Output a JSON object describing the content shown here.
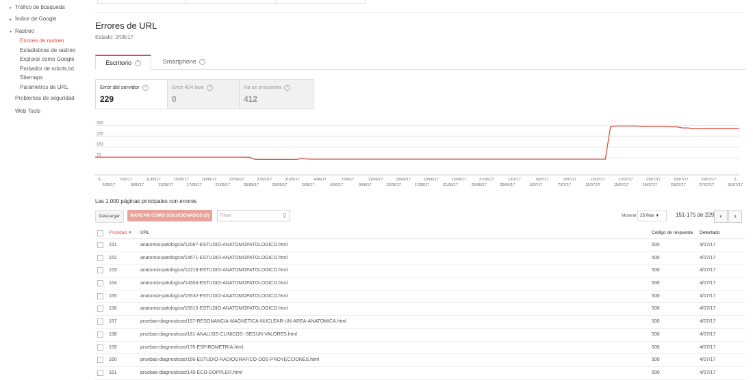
{
  "sidebar": {
    "traffic": "Tráfico de búsqueda",
    "index": "Índice de Google",
    "crawl": "Rastreo",
    "sub": [
      "Errores de rastreo",
      "Estadísticas de rastreo",
      "Explorar como Google",
      "Probador de robots.txt",
      "Sitemaps",
      "Parámetros de URL"
    ],
    "security": "Problemas de seguridad",
    "webtools": "Web Tools"
  },
  "header": {
    "title": "Errores de URL",
    "state": "Estado: 2/08/17"
  },
  "tabs": [
    {
      "label": "Escritorio"
    },
    {
      "label": "Smartphone"
    }
  ],
  "cards": [
    {
      "label": "Error del servidor",
      "value": "229"
    },
    {
      "label": "Error 404 leve",
      "value": "0"
    },
    {
      "label": "No se encuentra",
      "value": "412"
    }
  ],
  "chart_data": {
    "type": "line",
    "y_ticks": [
      300,
      225,
      150,
      75
    ],
    "ylim": [
      0,
      330
    ],
    "x_labels_top": [
      "3...",
      "7/05/17",
      "11/05/17",
      "15/05/17",
      "19/05/17",
      "23/05/17",
      "27/05/17",
      "31/05/17",
      "4/06/17",
      "7/06/17",
      "11/06/17",
      "15/06/17",
      "19/06/17",
      "23/06/17",
      "27/06/17",
      "1/07/17",
      "5/07/17",
      "9/07/17",
      "13/07/17",
      "17/07/17",
      "21/07/17",
      "25/07/17",
      "29/07/17",
      "2..."
    ],
    "x_labels_bottom": [
      "5/05/17",
      "9/05/17",
      "13/05/17",
      "17/05/17",
      "21/05/17",
      "25/05/17",
      "29/05/17",
      "2/06/17",
      "6/06/17",
      "9/06/17",
      "13/06/17",
      "17/06/17",
      "21/06/17",
      "25/06/17",
      "29/06/17",
      "3/07/17",
      "7/07/17",
      "11/07/17",
      "15/07/17",
      "19/07/17",
      "23/07/17",
      "27/07/17",
      "31/07/17"
    ],
    "series": [
      {
        "values": [
          80,
          80,
          80,
          80,
          80,
          80,
          80,
          80,
          80,
          80,
          80,
          80,
          80,
          80,
          80,
          80,
          80,
          80,
          80,
          80,
          80,
          80,
          80,
          80,
          80,
          80,
          80,
          80,
          80,
          80,
          79,
          65,
          64,
          64,
          64,
          64,
          64,
          64,
          64,
          64,
          70,
          68,
          66,
          66,
          66,
          66,
          66,
          66,
          66,
          66,
          66,
          66,
          66,
          66,
          66,
          66,
          66,
          66,
          66,
          66,
          66,
          66,
          66,
          66,
          66,
          66,
          66,
          66,
          66,
          66,
          66,
          66,
          66,
          66,
          66,
          66,
          66,
          66,
          66,
          66,
          66,
          66,
          66,
          66,
          66,
          66,
          66,
          66,
          66,
          66,
          66,
          66,
          66,
          66,
          66,
          66,
          66,
          66,
          66,
          66
        ]
      }
    ],
    "series_tail": [
      290,
      295,
      295,
      295,
      295,
      295,
      293,
      292,
      292,
      292,
      292,
      290,
      290,
      289,
      282,
      282,
      277,
      277,
      277,
      277,
      277,
      277,
      277,
      277,
      277,
      276
    ]
  },
  "table": {
    "subtitle": "Las 1.000 páginas principales con errores",
    "download": "Descargar",
    "mark": "MARCAR COMO SOLUCIONADOS (0)",
    "filter_placeholder": "Filtrar",
    "show_label": "Mostrar",
    "rows_select": "25 filas",
    "range": "151-175 de 229",
    "headers": {
      "priority": "Prioridad",
      "url": "URL",
      "code": "Código de respuesta",
      "detected": "Detectado"
    },
    "rows": [
      {
        "priority": "151",
        "url": "anatomia-patologica/12067-ESTUDIO-ANATOMOPATOLOGICO.html",
        "code": "500",
        "detected": "4/07/17"
      },
      {
        "priority": "152",
        "url": "anatomia-patologica/14671-ESTUDIO-ANATOMOPATOLOGICO.html",
        "code": "500",
        "detected": "4/07/17"
      },
      {
        "priority": "153",
        "url": "anatomia-patologica/12218-ESTUDIO-ANATOMOPATOLOGICO.html",
        "code": "500",
        "detected": "4/07/17"
      },
      {
        "priority": "154",
        "url": "anatomia-patologica/14304-ESTUDIO-ANATOMOPATOLOGICO.html",
        "code": "500",
        "detected": "4/07/17"
      },
      {
        "priority": "155",
        "url": "anatomia-patologica/15532-ESTUDIO-ANATOMOPATOLOGICO.html",
        "code": "500",
        "detected": "4/07/17"
      },
      {
        "priority": "156",
        "url": "anatomia-patologica/15515-ESTUDIO-ANATOMOPATOLOGICO.html",
        "code": "500",
        "detected": "4/07/17"
      },
      {
        "priority": "157",
        "url": "pruebas-diagnosticas/157-RESONANCIA-MAGNETICA-NUCLEAR-UN-AREA-ANATOMICA.html",
        "code": "500",
        "detected": "4/07/17"
      },
      {
        "priority": "158",
        "url": "pruebas-diagnosticas/181-ANALISIS-CLINICOS--SEGUN-VALORES.html",
        "code": "500",
        "detected": "4/07/17"
      },
      {
        "priority": "159",
        "url": "pruebas-diagnosticas/176-ESPIROMETRIA.html",
        "code": "500",
        "detected": "4/07/17"
      },
      {
        "priority": "160",
        "url": "pruebas-diagnosticas/166-ESTUDIO-RADIOGRAFICO-DOS-PROYECCIONES.html",
        "code": "500",
        "detected": "4/07/17"
      },
      {
        "priority": "161",
        "url": "pruebas-diagnosticas/149-ECO-DOPPLER.html",
        "code": "500",
        "detected": "4/07/17"
      }
    ]
  },
  "colors": {
    "accent": "#dd4b39",
    "line": "#dd4b39"
  }
}
